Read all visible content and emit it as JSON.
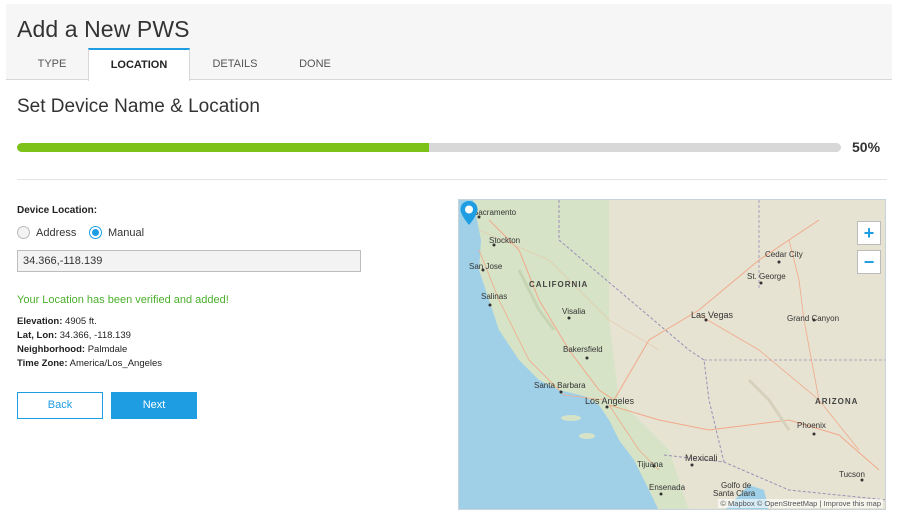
{
  "header": {
    "title": "Add a New PWS",
    "tabs": [
      {
        "label": "TYPE"
      },
      {
        "label": "LOCATION"
      },
      {
        "label": "DETAILS"
      },
      {
        "label": "DONE"
      }
    ]
  },
  "section": {
    "title": "Set Device Name & Location"
  },
  "progress": {
    "value": 0.5,
    "label": "50%",
    "fill_color": "#7cc219",
    "track_color": "#d8d8d8"
  },
  "form": {
    "device_location_label": "Device Location:",
    "radio_address_label": "Address",
    "radio_manual_label": "Manual",
    "selected_option": "Manual",
    "coordinates_value": "34.366,-118.139",
    "verified_message": "Your Location has been verified and added!",
    "elevation_label": "Elevation:",
    "elevation_value": "4905 ft.",
    "latlon_label": "Lat, Lon:",
    "latlon_value": "34.366, -118.139",
    "neighborhood_label": "Neighborhood:",
    "neighborhood_value": "Palmdale",
    "timezone_label": "Time Zone:",
    "timezone_value": "America/Los_Angeles",
    "back_label": "Back",
    "next_label": "Next"
  },
  "map": {
    "labels": {
      "sacramento": "Sacramento",
      "stockton": "Stockton",
      "san_jose": "San Jose",
      "california": "CALIFORNIA",
      "salinas": "Salinas",
      "visalia": "Visalia",
      "bakersfield": "Bakersfield",
      "santa_barbara": "Santa Barbara",
      "los_angeles": "Los Angeles",
      "las_vegas": "Las Vegas",
      "cedar_city": "Cedar City",
      "st_george": "St. George",
      "grand_canyon": "Grand Canyon",
      "arizona": "ARIZONA",
      "phoenix": "Phoenix",
      "tucson": "Tucson",
      "mexicali": "Mexicali",
      "tijuana": "Tijuana",
      "ensenada": "Ensenada",
      "golfo": "Golfo de",
      "santa_clara": "Santa Clara"
    },
    "zoom_in": "+",
    "zoom_out": "−",
    "attribution": "© Mapbox © OpenStreetMap | Improve this map",
    "icons": {
      "pin": "map-pin-icon"
    },
    "colors": {
      "water": "#9fd0e8",
      "land": "#d6e3c6",
      "desert": "#e7e4d4",
      "road": "#f2a98a",
      "pin": "#1e9de2"
    }
  },
  "colors": {
    "accent": "#1e9de2",
    "success": "#4caf2c"
  }
}
